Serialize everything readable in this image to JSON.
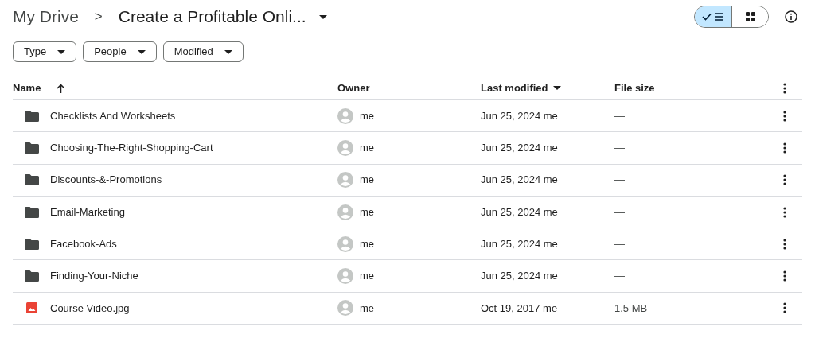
{
  "breadcrumb": {
    "root": "My Drive",
    "separator": ">",
    "current": "Create a Profitable Onli..."
  },
  "view_toggle": [
    {
      "kind": "list",
      "selected": true
    },
    {
      "kind": "grid",
      "selected": false
    }
  ],
  "filters": [
    "Type",
    "People",
    "Modified"
  ],
  "columns": {
    "name": "Name",
    "owner": "Owner",
    "modified": "Last modified",
    "size": "File size"
  },
  "rows": [
    {
      "kind": "folder",
      "name": "Checklists And Worksheets",
      "owner": "me",
      "modified": "Jun 25, 2024 me",
      "size": "—"
    },
    {
      "kind": "folder",
      "name": "Choosing-The-Right-Shopping-Cart",
      "owner": "me",
      "modified": "Jun 25, 2024 me",
      "size": "—"
    },
    {
      "kind": "folder",
      "name": "Discounts-&-Promotions",
      "owner": "me",
      "modified": "Jun 25, 2024 me",
      "size": "—"
    },
    {
      "kind": "folder",
      "name": "Email-Marketing",
      "owner": "me",
      "modified": "Jun 25, 2024 me",
      "size": "—"
    },
    {
      "kind": "folder",
      "name": "Facebook-Ads",
      "owner": "me",
      "modified": "Jun 25, 2024 me",
      "size": "—"
    },
    {
      "kind": "folder",
      "name": "Finding-Your-Niche",
      "owner": "me",
      "modified": "Jun 25, 2024 me",
      "size": "—"
    },
    {
      "kind": "image",
      "name": "Course Video.jpg",
      "owner": "me",
      "modified": "Oct 19, 2017 me",
      "size": "1.5 MB"
    }
  ]
}
